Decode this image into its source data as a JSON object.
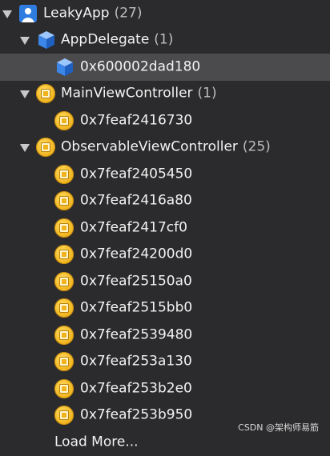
{
  "tree": {
    "root": {
      "name": "LeakyApp",
      "count": "(27)"
    },
    "app_delegate": {
      "name": "AppDelegate",
      "count": "(1)",
      "instances": [
        "0x600002dad180"
      ]
    },
    "main_vc": {
      "name": "MainViewController",
      "count": "(1)",
      "instances": [
        "0x7feaf2416730"
      ]
    },
    "observable_vc": {
      "name": "ObservableViewController",
      "count": "(25)",
      "instances": [
        "0x7feaf2405450",
        "0x7feaf2416a80",
        "0x7feaf2417cf0",
        "0x7feaf24200d0",
        "0x7feaf25150a0",
        "0x7feaf2515bb0",
        "0x7feaf2539480",
        "0x7feaf253a130",
        "0x7feaf253b2e0",
        "0x7feaf253b950"
      ]
    },
    "load_more": "Load More..."
  },
  "watermark": "CSDN @架构师易筋",
  "icons": {
    "root": "app-target-icon",
    "app_delegate": "cube-icon",
    "object": "object-instance-icon"
  }
}
